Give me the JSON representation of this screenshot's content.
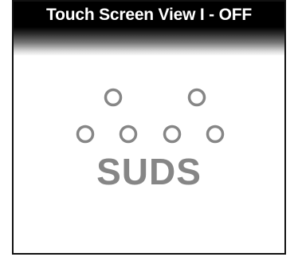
{
  "header": {
    "title": "Touch Screen View I - OFF"
  },
  "main": {
    "icon_name": "suds-bubbles-icon",
    "label": "SUDS"
  },
  "colors": {
    "titlebar_bg": "#000000",
    "title_text": "#ffffff",
    "icon_gray": "#868686"
  }
}
